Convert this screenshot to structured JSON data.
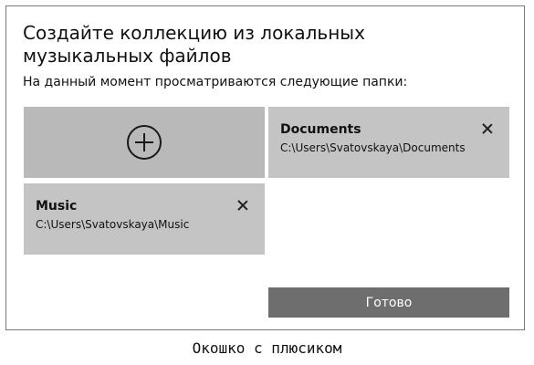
{
  "dialog": {
    "title": "Создайте коллекцию из локальных музыкальных файлов",
    "subtitle": "На данный момент просматриваются следующие папки:",
    "add_folder_icon": "plus-circle-icon",
    "folders": [
      {
        "name": "Documents",
        "path": "C:\\Users\\Svatovskaya\\Documents",
        "remove_icon": "close-icon"
      },
      {
        "name": "Music",
        "path": "C:\\Users\\Svatovskaya\\Music",
        "remove_icon": "close-icon"
      }
    ],
    "done_label": "Готово"
  },
  "caption": "Окошко с плюсиком",
  "colors": {
    "tile_add": "#b9b9b9",
    "tile_folder": "#c4c4c4",
    "button": "#6e6e6e",
    "border": "#7a7a7a"
  }
}
